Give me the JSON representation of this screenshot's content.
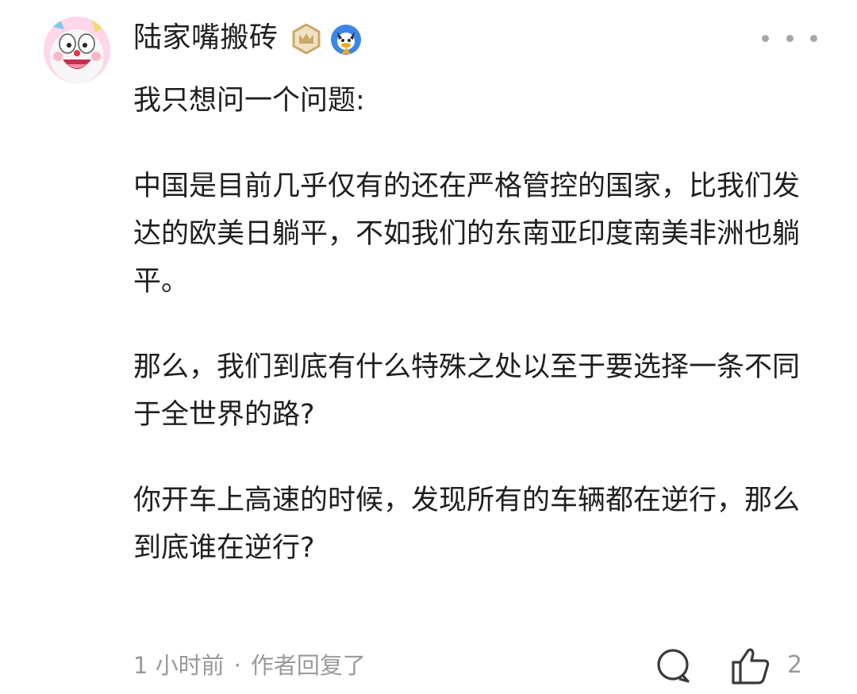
{
  "comment": {
    "username": "陆家嘴搬砖",
    "avatar_icon": "cartoon-cat-avatar",
    "badges": [
      "crown-badge-icon",
      "duck-badge-icon"
    ],
    "more_icon": "more-dots-icon",
    "paragraphs": [
      "我只想问一个问题:",
      "中国是目前几乎仅有的还在严格管控的国家，比我们发达的欧美日躺平，不如我们的东南亚印度南美非洲也躺平。",
      "那么，我们到底有什么特殊之处以至于要选择一条不同于全世界的路?",
      "你开车上高速的时候，发现所有的车辆都在逆行，那么到底谁在逆行?"
    ],
    "timestamp": "1 小时前",
    "separator": "·",
    "author_replied": "作者回复了",
    "like_count": "2",
    "colors": {
      "text": "#1f1f1f",
      "meta": "#9a9a9a",
      "badge_gold": "#c9a86a",
      "badge_blue": "#3d86e8"
    }
  }
}
